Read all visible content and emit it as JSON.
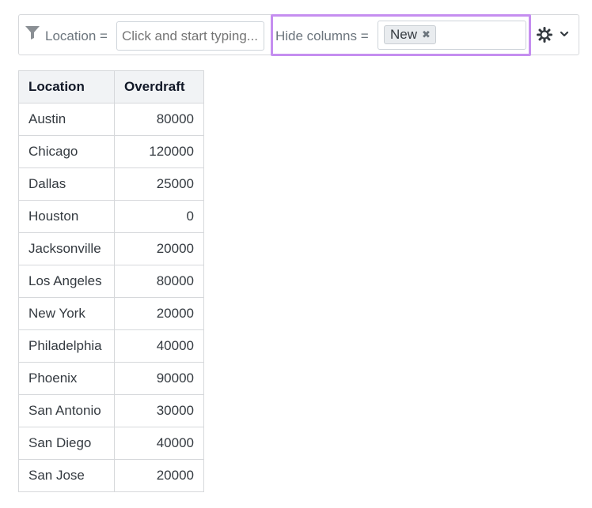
{
  "toolbar": {
    "location_label": "Location =",
    "location_placeholder": "Click and start typing...",
    "hide_columns_label": "Hide columns =",
    "hidden_tag": "New",
    "tag_remove": "✖",
    "icons": [
      "filter-icon",
      "gear-icon",
      "chevron-down-icon"
    ]
  },
  "table": {
    "headers": [
      "Location",
      "Overdraft"
    ],
    "rows": [
      [
        "Austin",
        "80000"
      ],
      [
        "Chicago",
        "120000"
      ],
      [
        "Dallas",
        "25000"
      ],
      [
        "Houston",
        "0"
      ],
      [
        "Jacksonville",
        "20000"
      ],
      [
        "Los Angeles",
        "80000"
      ],
      [
        "New York",
        "20000"
      ],
      [
        "Philadelphia",
        "40000"
      ],
      [
        "Phoenix",
        "90000"
      ],
      [
        "San Antonio",
        "30000"
      ],
      [
        "San Diego",
        "40000"
      ],
      [
        "San Jose",
        "20000"
      ]
    ]
  },
  "colors": {
    "highlight_border": "#c58ef0",
    "header_bg": "#f1f3f5",
    "border": "#d6d8db"
  }
}
